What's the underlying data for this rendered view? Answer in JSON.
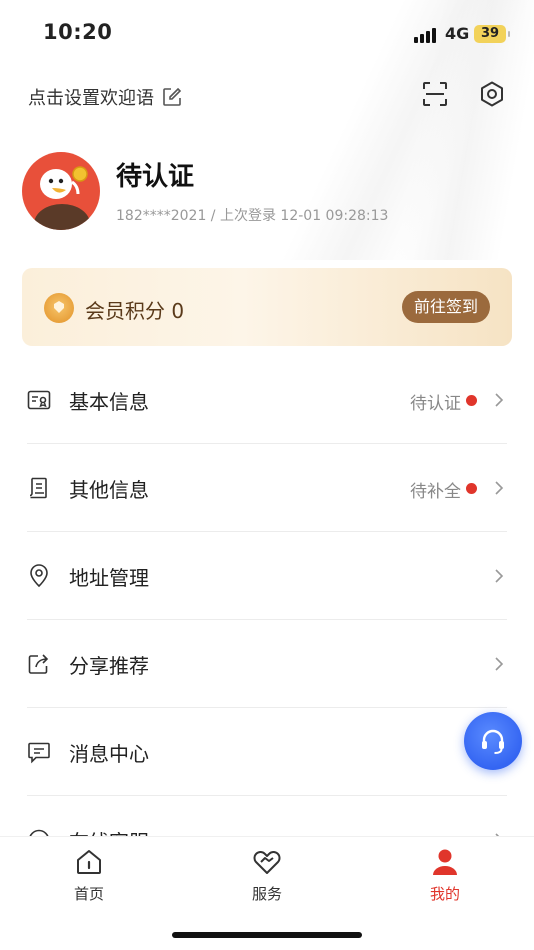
{
  "status_bar": {
    "time": "10:20",
    "network": "4G",
    "battery": "39"
  },
  "header": {
    "welcome_text": "点击设置欢迎语",
    "icons": [
      "edit-icon",
      "scan-icon",
      "settings-icon"
    ]
  },
  "profile": {
    "name": "待认证",
    "info": "182****2021 / 上次登录 12-01 09:28:13"
  },
  "member": {
    "label": "会员积分 0",
    "signin_button": "前往签到"
  },
  "menu": {
    "items": [
      {
        "label": "基本信息",
        "status": "待认证",
        "icon": "id-card-icon"
      },
      {
        "label": "其他信息",
        "status": "待补全",
        "icon": "document-icon"
      },
      {
        "label": "地址管理",
        "icon": "location-icon"
      },
      {
        "label": "分享推荐",
        "icon": "share-icon"
      },
      {
        "label": "消息中心",
        "icon": "message-icon"
      },
      {
        "label": "在线客服",
        "icon": "chat-icon"
      }
    ]
  },
  "tabbar": {
    "tabs": [
      {
        "label": "首页",
        "icon": "home-icon"
      },
      {
        "label": "服务",
        "icon": "heart-handshake-icon"
      },
      {
        "label": "我的",
        "icon": "profile-icon"
      }
    ],
    "active": "我的"
  },
  "colors": {
    "accent_red": "#e0352b",
    "gold_button": "#9b6a3d",
    "fab_blue": "#3465f2"
  }
}
